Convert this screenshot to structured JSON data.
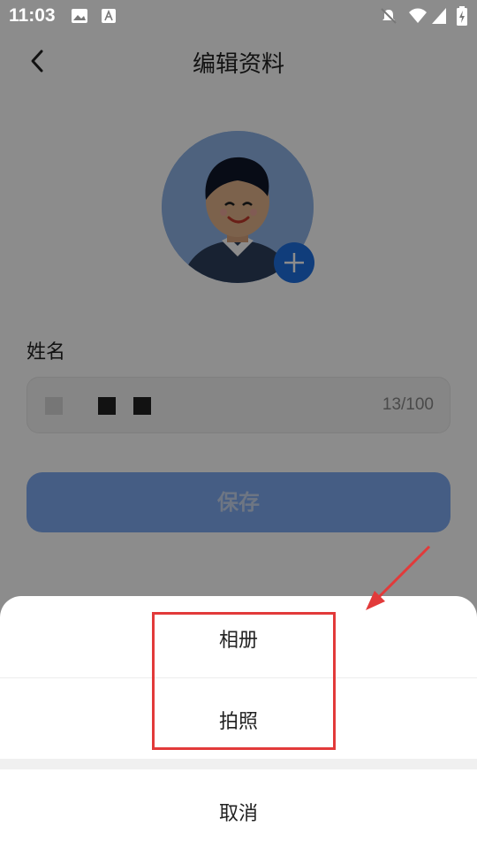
{
  "status_bar": {
    "time": "11:03"
  },
  "header": {
    "title": "编辑资料"
  },
  "form": {
    "name_label": "姓名",
    "name_counter": "13/100",
    "save_label": "保存"
  },
  "action_sheet": {
    "album_label": "相册",
    "photo_label": "拍照",
    "cancel_label": "取消"
  },
  "colors": {
    "accent_blue": "#1e6fe0",
    "save_button": "#7ea9f0",
    "highlight_red": "#e23a3a"
  }
}
